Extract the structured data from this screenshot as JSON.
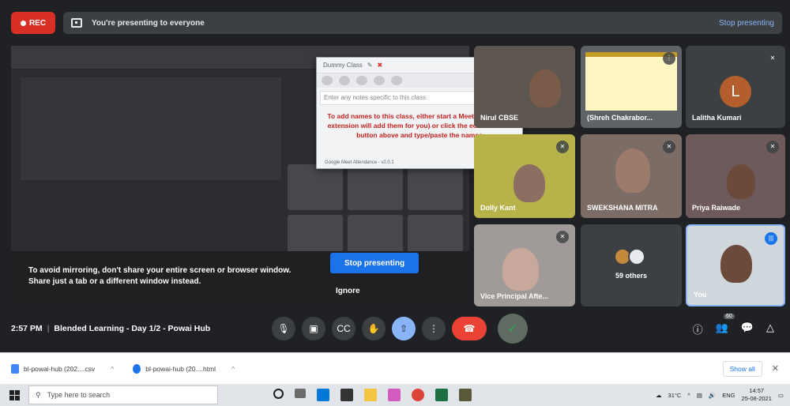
{
  "topbar": {
    "rec_label": "REC",
    "presenting_text": "You're presenting to everyone",
    "stop_link": "Stop presenting"
  },
  "warning": {
    "line1": "To avoid mirroring, don't share your entire screen or browser window.",
    "line2": "Share just a tab or a different window instead.",
    "stop_button": "Stop presenting",
    "ignore_button": "Ignore"
  },
  "extension": {
    "class_name": "Dummy Class",
    "notes_placeholder": "Enter any notes specific to this class.",
    "message": "To add names to this class, either start a Meet (and let the extension will add them for you) or click the edit class list button above and type/paste the names",
    "footer": "Google Meet Attendance - v2.0.1"
  },
  "tiles": [
    {
      "name": "Nirul CBSE"
    },
    {
      "name": "(Shreh Chakrabor..."
    },
    {
      "name": "Lalitha Kumari",
      "initial": "L"
    },
    {
      "name": "Dolly Kant"
    },
    {
      "name": "SWEKSHANA MITRA"
    },
    {
      "name": "Priya Raiwade"
    },
    {
      "name": "Vice Principal Afte..."
    },
    {
      "name": "59 others"
    },
    {
      "name": "You"
    }
  ],
  "controls": {
    "time": "2:57 PM",
    "meeting_title": "Blended Learning - Day 1/2 - Powai Hub",
    "participant_count": "60"
  },
  "downloads": [
    {
      "name": "bl-powai-hub (202....csv"
    },
    {
      "name": "bl-powai-hub (20....html"
    }
  ],
  "downloads_bar": {
    "show_all": "Show all"
  },
  "taskbar": {
    "search_placeholder": "Type here to search",
    "temperature": "31°C",
    "language": "ENG",
    "time": "14:57",
    "date": "25-08-2021"
  }
}
